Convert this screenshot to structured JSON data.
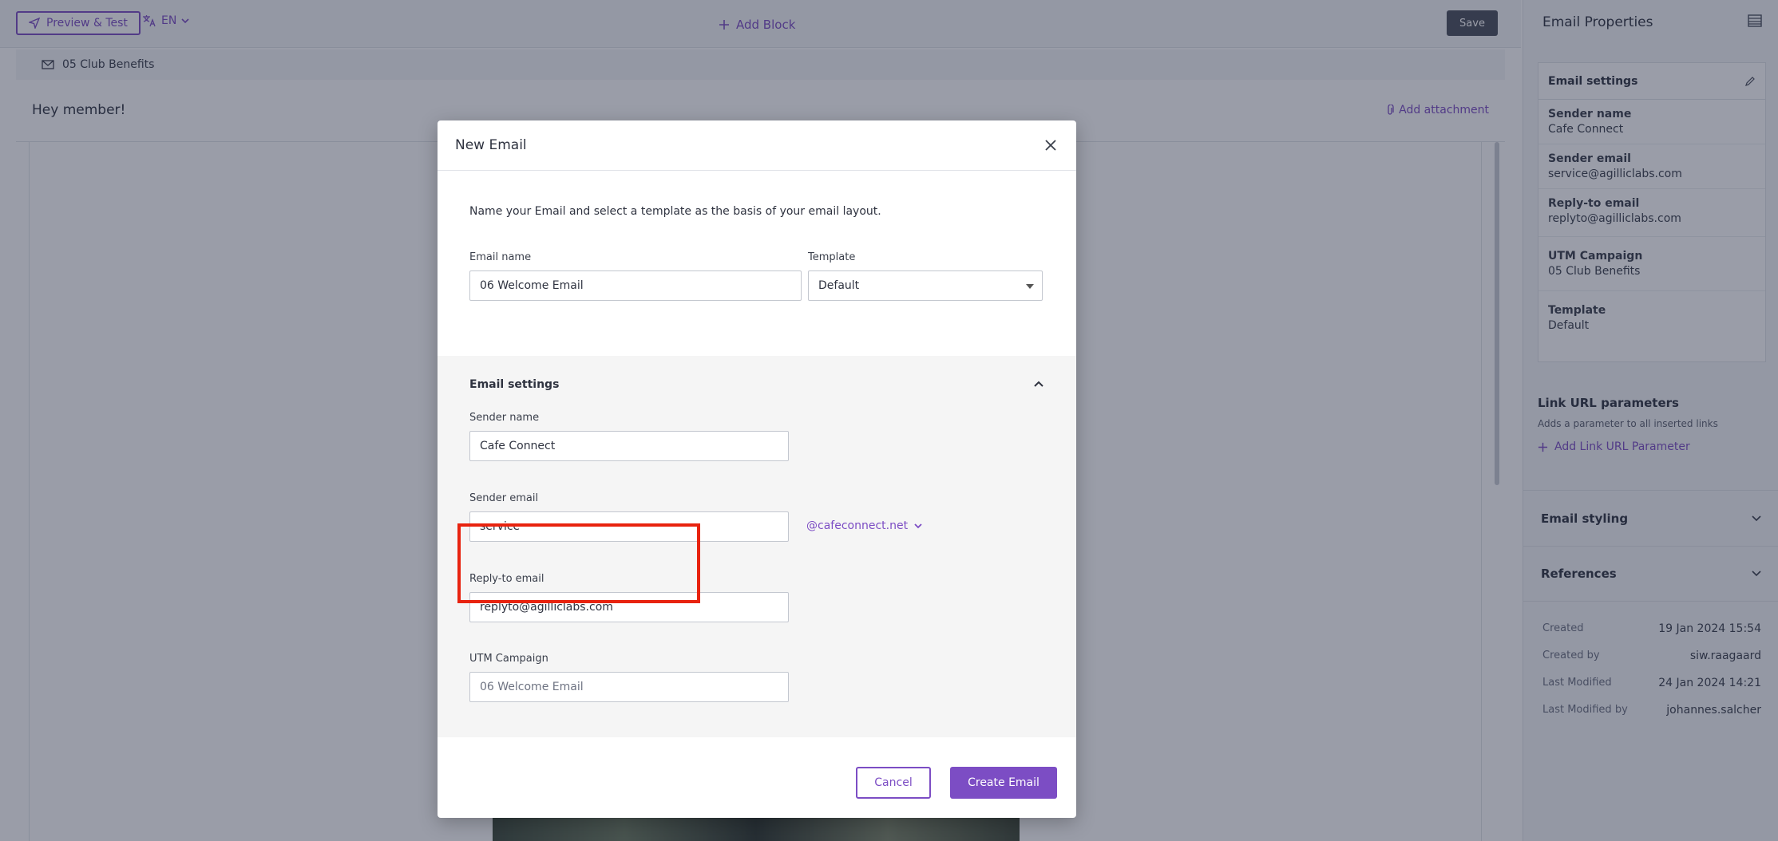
{
  "toolbar": {
    "preview_label": "Preview & Test",
    "language": "EN",
    "add_block_label": "Add Block",
    "save_label": "Save"
  },
  "editor": {
    "subject": "05 Club Benefits",
    "greeting": "Hey member!",
    "add_attachment_label": "Add attachment"
  },
  "right_panel": {
    "title": "Email Properties",
    "settings_card": {
      "title": "Email settings",
      "rows": [
        {
          "label": "Sender name",
          "value": "Cafe Connect"
        },
        {
          "label": "Sender email",
          "value": "service@agilliclabs.com"
        },
        {
          "label": "Reply-to email",
          "value": "replyto@agilliclabs.com"
        },
        {
          "label": "UTM Campaign",
          "value": "05 Club Benefits"
        },
        {
          "label": "Template",
          "value": "Default"
        }
      ]
    },
    "link_params": {
      "title": "Link URL parameters",
      "description": "Adds a parameter to all inserted links",
      "add_label": "Add Link URL Parameter"
    },
    "email_styling_label": "Email styling",
    "references_label": "References",
    "meta": [
      {
        "label": "Created",
        "value": "19 Jan 2024 15:54"
      },
      {
        "label": "Created by",
        "value": "siw.raagaard"
      },
      {
        "label": "Last Modified",
        "value": "24 Jan 2024 14:21"
      },
      {
        "label": "Last Modified by",
        "value": "johannes.salcher"
      }
    ]
  },
  "modal": {
    "title": "New Email",
    "intro": "Name your Email and select a template as the basis of your email layout.",
    "email_name_label": "Email name",
    "email_name_value": "06 Welcome Email",
    "template_label": "Template",
    "template_value": "Default",
    "settings_title": "Email settings",
    "sender_name_label": "Sender name",
    "sender_name_value": "Cafe Connect",
    "sender_email_label": "Sender email",
    "sender_email_value": "service",
    "sender_domain": "@cafeconnect.net",
    "reply_to_label": "Reply-to email",
    "reply_to_value": "replyto@agilliclabs.com",
    "utm_label": "UTM Campaign",
    "utm_placeholder": "06 Welcome Email",
    "cancel_label": "Cancel",
    "create_label": "Create Email"
  },
  "colors": {
    "accent": "#7c4dc4",
    "highlight": "#e8230f"
  }
}
